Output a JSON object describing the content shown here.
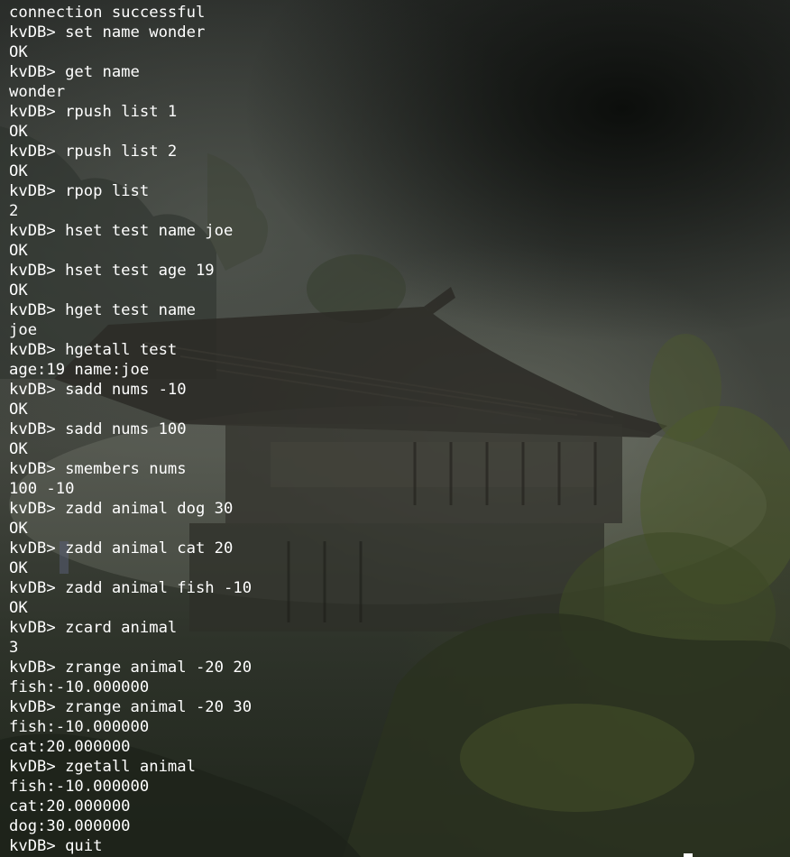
{
  "terminal": {
    "lines": [
      "connection successful",
      "kvDB> set name wonder",
      "OK",
      "kvDB> get name",
      "wonder",
      "kvDB> rpush list 1",
      "OK",
      "kvDB> rpush list 2",
      "OK",
      "kvDB> rpop list",
      "2",
      "kvDB> hset test name joe",
      "OK",
      "kvDB> hset test age 19",
      "OK",
      "kvDB> hget test name",
      "joe",
      "kvDB> hgetall test",
      "age:19 name:joe",
      "kvDB> sadd nums -10",
      "OK",
      "kvDB> sadd nums 100",
      "OK",
      "kvDB> smembers nums",
      "100 -10",
      "kvDB> zadd animal dog 30",
      "OK",
      "kvDB> zadd animal cat 20",
      "OK",
      "kvDB> zadd animal fish -10",
      "OK",
      "kvDB> zcard animal",
      "3",
      "kvDB> zrange animal -20 20",
      "fish:-10.000000",
      "kvDB> zrange animal -20 30",
      "fish:-10.000000",
      "cat:20.000000",
      "kvDB> zgetall animal",
      "fish:-10.000000",
      "cat:20.000000",
      "dog:30.000000",
      "kvDB> quit"
    ],
    "text_color": "#ffffff"
  }
}
